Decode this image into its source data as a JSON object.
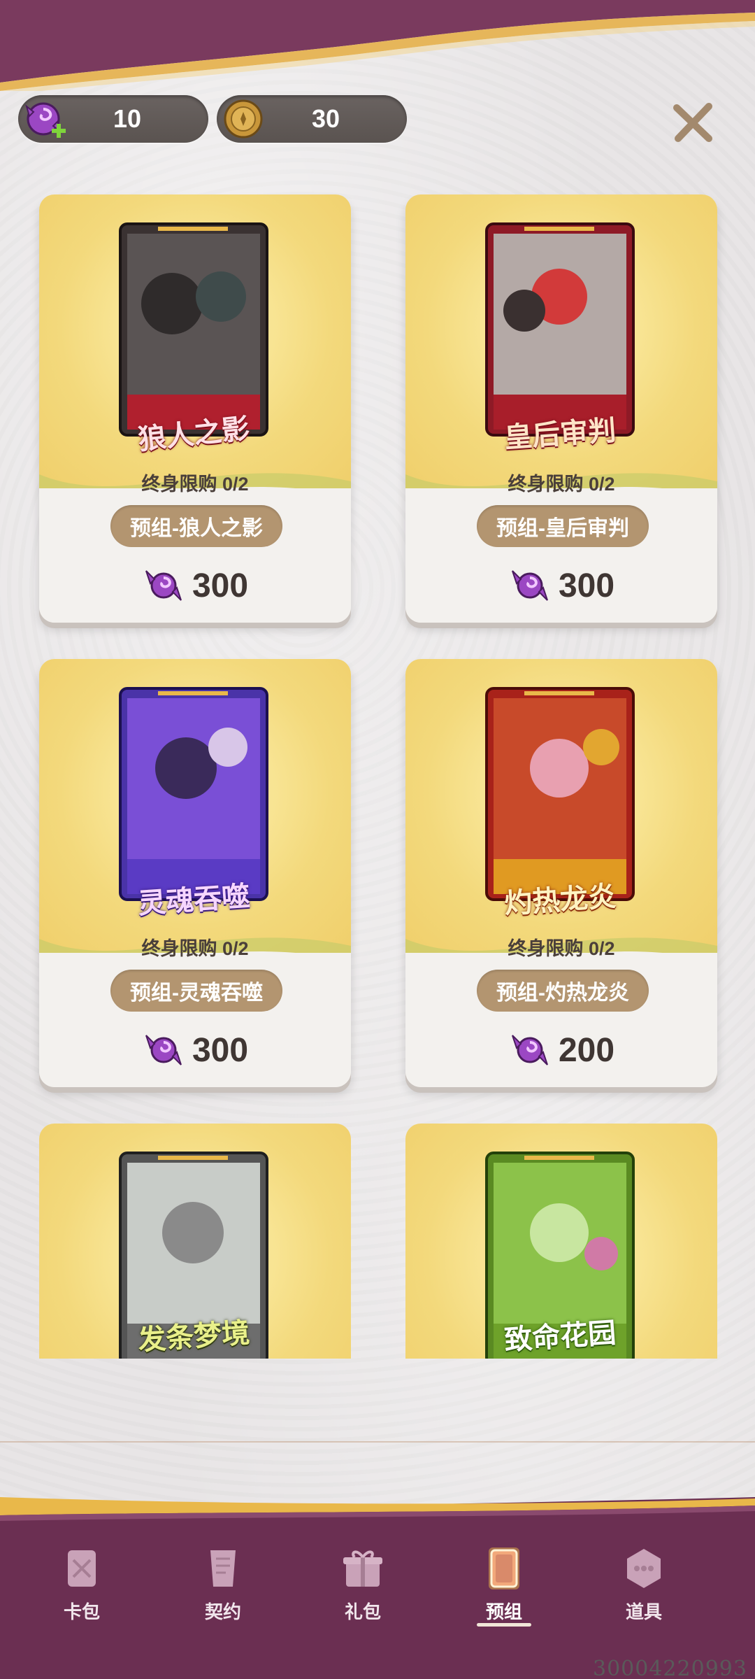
{
  "currencies": [
    {
      "icon": "candy-plus-icon",
      "value": "10"
    },
    {
      "icon": "gold-coin-icon",
      "value": "30"
    }
  ],
  "cards": [
    {
      "pack_title": "狼人之影",
      "limit": "终身限购 0/2",
      "name": "预组-狼人之影",
      "price": "300",
      "pack_color": "#b0202e"
    },
    {
      "pack_title": "皇后审判",
      "limit": "终身限购 0/2",
      "name": "预组-皇后审判",
      "price": "300",
      "pack_color": "#a81e2a"
    },
    {
      "pack_title": "灵魂吞噬",
      "limit": "终身限购 0/2",
      "name": "预组-灵魂吞噬",
      "price": "300",
      "pack_color": "#5a3bc4"
    },
    {
      "pack_title": "灼热龙炎",
      "limit": "终身限购 0/2",
      "name": "预组-灼热龙炎",
      "price": "200",
      "pack_color": "#b22a1f"
    },
    {
      "pack_title": "发条梦境",
      "pack_color": "#6d6d6d"
    },
    {
      "pack_title": "致命花园",
      "pack_color": "#6ea22a"
    }
  ],
  "nav": {
    "items": [
      {
        "label": "卡包",
        "icon": "card-pack-icon"
      },
      {
        "label": "契约",
        "icon": "contract-icon"
      },
      {
        "label": "礼包",
        "icon": "gift-icon"
      },
      {
        "label": "预组",
        "icon": "preset-deck-icon"
      },
      {
        "label": "道具",
        "icon": "items-icon"
      }
    ],
    "active": "预组"
  },
  "build_id": "30004220993",
  "colors": {
    "nav_bg": "#6b2f52",
    "accent_gold": "#e9b84a",
    "pill_brown": "#b39570",
    "candy_purple": "#8a3fb0"
  }
}
